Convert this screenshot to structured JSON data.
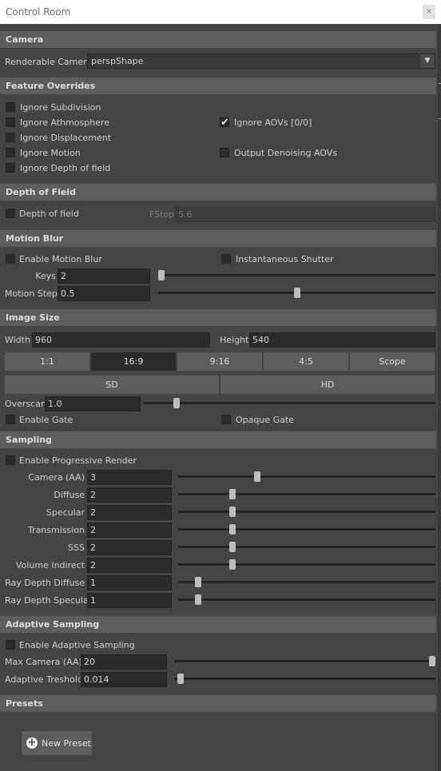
{
  "window": {
    "title": "Control Room",
    "close_icon": "close-icon"
  },
  "camera": {
    "section": "Camera",
    "renderable_label": "Renderable Camera",
    "renderable_value": "perspShape"
  },
  "features": {
    "section": "Feature Overrides",
    "ignore_subdivision": {
      "label": "Ignore Subdivision",
      "checked": false
    },
    "ignore_atmosphere": {
      "label": "Ignore Athmosphere",
      "checked": false
    },
    "ignore_displacement": {
      "label": "Ignore Displacement",
      "checked": false
    },
    "ignore_motion": {
      "label": "Ignore Motion",
      "checked": false
    },
    "ignore_dof": {
      "label": "Ignore Depth of field",
      "checked": false
    },
    "ignore_aovs": {
      "label": "Ignore AOVs [0/0]",
      "checked": true
    },
    "output_denoising": {
      "label": "Output Denoising AOVs",
      "checked": false
    }
  },
  "dof": {
    "section": "Depth of Field",
    "enable_label": "Depth of field",
    "fstop_label": "FStop",
    "fstop_value": "5.6"
  },
  "motion": {
    "section": "Motion Blur",
    "enable_label": "Enable Motion Blur",
    "instant_label": "Instantaneous Shutter",
    "keys_label": "Keys",
    "keys_value": "2",
    "step_label": "Motion Step",
    "step_value": "0.5"
  },
  "image": {
    "section": "Image Size",
    "width_label": "Width",
    "width_value": "960",
    "height_label": "Height",
    "height_value": "540",
    "ratios": [
      "1:1",
      "16:9",
      "9:16",
      "4:5",
      "Scope"
    ],
    "active_ratio": "16:9",
    "sd_label": "SD",
    "hd_label": "HD",
    "overscan_label": "Overscan",
    "overscan_value": "1.0",
    "enable_gate_label": "Enable Gate",
    "opaque_gate_label": "Opaque Gate"
  },
  "sampling": {
    "section": "Sampling",
    "progressive_label": "Enable Progressive Render",
    "rows": [
      {
        "label": "Camera (AA)",
        "value": "3"
      },
      {
        "label": "Diffuse",
        "value": "2"
      },
      {
        "label": "Specular",
        "value": "2"
      },
      {
        "label": "Transmission",
        "value": "2"
      },
      {
        "label": "SSS",
        "value": "2"
      },
      {
        "label": "Volume Indirect",
        "value": "2"
      },
      {
        "label": "Ray Depth Diffuse",
        "value": "1"
      },
      {
        "label": "Ray Depth Specular",
        "value": "1"
      }
    ]
  },
  "adaptive": {
    "section": "Adaptive Sampling",
    "enable_label": "Enable Adaptive Sampling",
    "max_label": "Max Camera (AA)",
    "max_value": "20",
    "threshold_label": "Adaptive Treshold",
    "threshold_value": "0.014"
  },
  "presets": {
    "section": "Presets",
    "new_label": "New Preset",
    "new_icon": "plus-circle-icon"
  },
  "colors": {
    "background": "#444444",
    "section_header": "#5d5d5d",
    "field": "#2b2b2b",
    "title_bar": "#ffffff"
  }
}
